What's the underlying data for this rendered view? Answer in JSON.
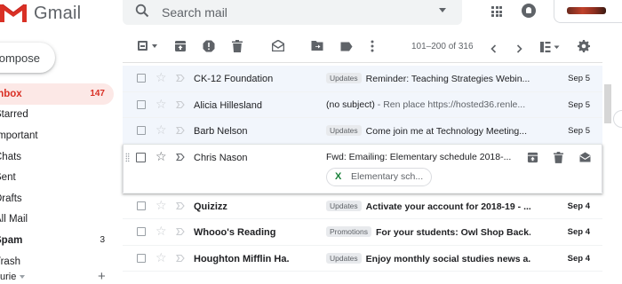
{
  "app": {
    "name": "Gmail"
  },
  "search": {
    "placeholder": "Search mail"
  },
  "sidebar": {
    "compose": "Compose",
    "items": [
      {
        "label": "Inbox",
        "count": "147"
      },
      {
        "label": "Starred",
        "count": ""
      },
      {
        "label": "Important",
        "count": ""
      },
      {
        "label": "Chats",
        "count": ""
      },
      {
        "label": "Sent",
        "count": ""
      },
      {
        "label": "Drafts",
        "count": ""
      },
      {
        "label": "All Mail",
        "count": ""
      },
      {
        "label": "Spam",
        "count": "3"
      },
      {
        "label": "Trash",
        "count": ""
      }
    ],
    "user_label": "urie"
  },
  "toolbar": {
    "pagination": "101–200 of 316"
  },
  "emails": [
    {
      "sender": "CK-12 Foundation",
      "tag": "Updates",
      "subject": "Reminder: Teaching Strategies Webin...",
      "snippet": "",
      "date": "Sep 5"
    },
    {
      "sender": "Alicia Hillesland",
      "tag": "",
      "subject": "(no subject)",
      "snippet": " - Ren place https://hosted36.renle...",
      "date": "Sep 5"
    },
    {
      "sender": "Barb Nelson",
      "tag": "Updates",
      "subject": "Come join me at Technology Meeting...",
      "snippet": "",
      "date": "Sep 5"
    },
    {
      "sender": "Chris Nason",
      "tag": "",
      "subject": "Fwd: Emailing: Elementary schedule 2018-...",
      "snippet": "",
      "date": "",
      "attachment": "Elementary sch..."
    },
    {
      "sender": "Quizizz",
      "tag": "Updates",
      "subject": "Activate your account for 2018-19 - ...",
      "snippet": "",
      "date": "Sep 4"
    },
    {
      "sender": "Whooo's Reading",
      "tag": "Promotions",
      "subject": "For your students: Owl Shop Back...",
      "snippet": "",
      "date": "Sep 4"
    },
    {
      "sender": "Houghton Mifflin Ha.",
      "tag": "Updates",
      "subject": "Enjoy monthly social studies news a...",
      "snippet": "",
      "date": "Sep 4"
    }
  ],
  "colors": {
    "accent": "#d93025",
    "active_bg": "#fce8e6",
    "read_row_bg": "#f2f6fc"
  },
  "icons": [
    "gmail-logo-icon",
    "search-icon",
    "apps-grid-icon",
    "notifications-icon",
    "select-all-checkbox-icon",
    "archive-icon",
    "report-spam-icon",
    "delete-icon",
    "mark-read-icon",
    "move-to-icon",
    "label-icon",
    "more-icon",
    "newer-icon",
    "older-icon",
    "split-pane-icon",
    "settings-icon",
    "star-icon",
    "important-marker-icon",
    "spreadsheet-icon"
  ]
}
